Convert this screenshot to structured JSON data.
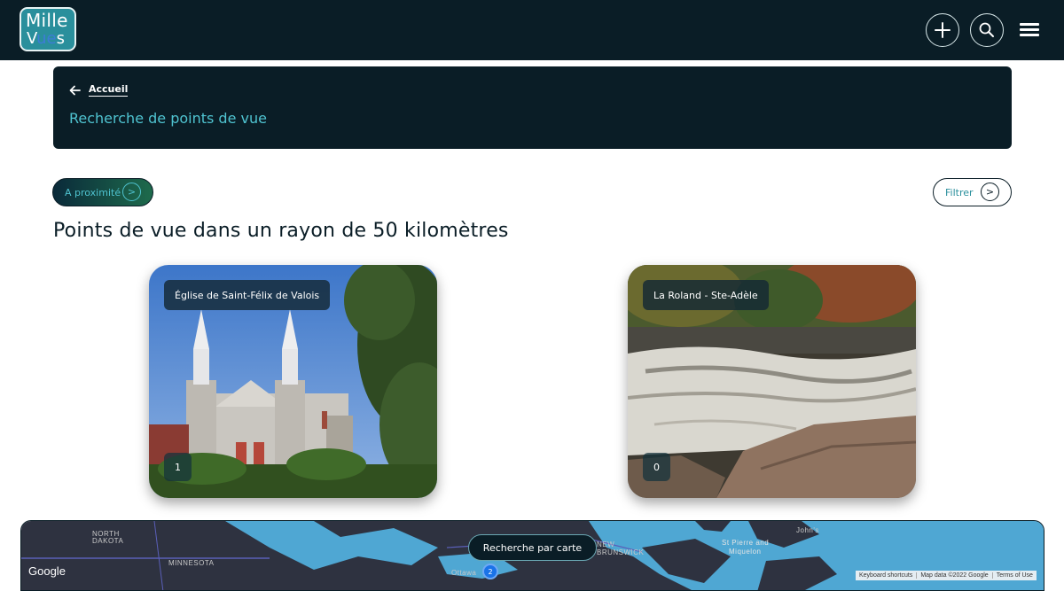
{
  "app": {
    "logo_line1": "Mille",
    "logo_line2_a": "V",
    "logo_line2_eye": "ue",
    "logo_line2_b": "s"
  },
  "header": {
    "back_label": "Accueil",
    "title": "Recherche de points de vue"
  },
  "filters": {
    "nearby_label": "A proximité",
    "nearby_arrow": ">",
    "filter_label": "Filtrer",
    "filter_arrow": ">"
  },
  "section": {
    "title": "Points de vue dans un rayon de 50 kilomètres"
  },
  "cards": [
    {
      "name": "Église de Saint-Félix de Valois",
      "count": "1"
    },
    {
      "name": "La Roland - Ste-Adèle",
      "count": "0"
    }
  ],
  "map": {
    "button_label": "Recherche par carte",
    "google_label": "Google",
    "attribution": [
      "Keyboard shortcuts",
      "Map data ©2022 Google",
      "Terms of Use"
    ],
    "places": [
      "NORTH",
      "DAKOTA",
      "MINNESOTA",
      "NEW",
      "BRUNSWICK",
      "St Pierre and",
      "Miquelon",
      "John's",
      "Ottawa"
    ],
    "cluster_count": "2"
  },
  "colors": {
    "dark": "#0a1d26",
    "accent": "#4fc3d0",
    "teal": "#2a8f9c"
  }
}
